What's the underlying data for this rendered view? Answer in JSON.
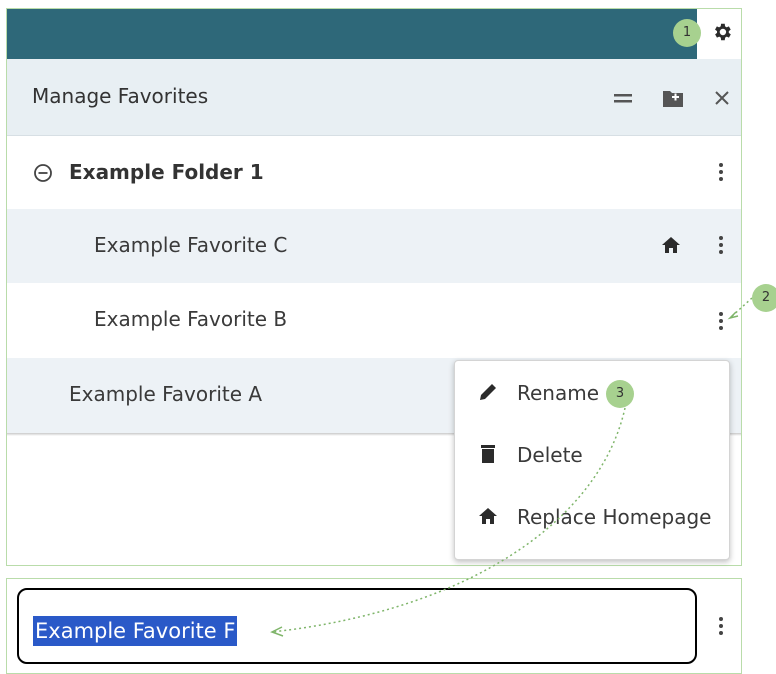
{
  "panel": {
    "title": "Manage Favorites",
    "header_icons": [
      "menu-lines-icon",
      "add-folder-icon",
      "close-icon"
    ],
    "folder": {
      "label": "Example Folder 1",
      "icon": "collapse-circle-icon"
    },
    "rows": [
      {
        "label": "Example Favorite C",
        "home": true
      },
      {
        "label": "Example Favorite B",
        "home": false
      },
      {
        "label": "Example Favorite A",
        "home": false
      }
    ]
  },
  "context_menu": {
    "items": [
      {
        "label": "Rename",
        "icon": "pencil-icon"
      },
      {
        "label": "Delete",
        "icon": "trash-icon"
      },
      {
        "label": "Replace Homepage",
        "icon": "home-icon"
      }
    ]
  },
  "rename_field": {
    "value": "Example Favorite F"
  },
  "callouts": [
    "1",
    "2",
    "3"
  ],
  "colors": {
    "topbar": "#2e6879",
    "header": "#e8eff3",
    "badge": "#a7d18f",
    "selection": "#2a59c8"
  }
}
